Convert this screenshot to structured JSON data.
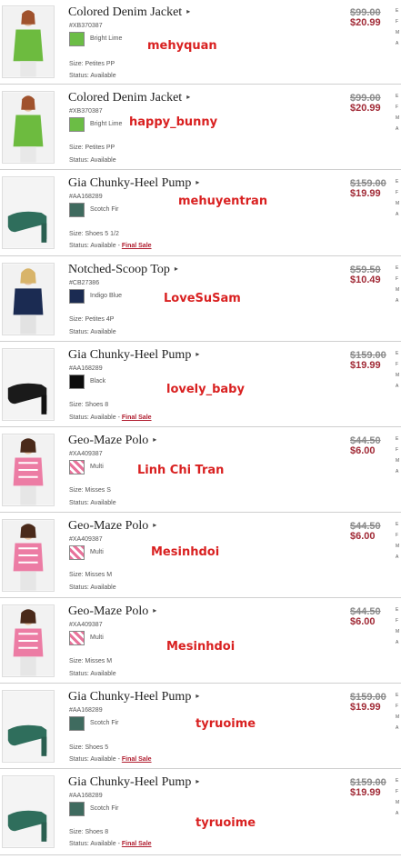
{
  "rows": [
    {
      "name": "Colored Denim Jacket",
      "sku": "#XB370387",
      "color_name": "Bright Lime",
      "swatch": "#6bbd45",
      "size": "Size: Petites  PP",
      "status": "Status: Available",
      "final_sale": "",
      "old_price": "$99.00",
      "new_price": "$20.99",
      "overlay": "mehyquan",
      "image": "green-jacket-model"
    },
    {
      "name": "Colored Denim Jacket",
      "sku": "#XB370387",
      "color_name": "Bright Lime",
      "swatch": "#6bbd45",
      "size": "Size: Petites  PP",
      "status": "Status: Available",
      "final_sale": "",
      "old_price": "$99.00",
      "new_price": "$20.99",
      "overlay": "happy_bunny",
      "image": "green-jacket-model"
    },
    {
      "name": "Gia Chunky-Heel Pump",
      "sku": "#AA168289",
      "color_name": "Scotch Fir",
      "swatch": "#3f6b5f",
      "size": "Size: Shoes  5 1/2",
      "status": "Status: Available - ",
      "final_sale": "Final Sale",
      "old_price": "$159.00",
      "new_price": "$19.99",
      "overlay": "mehuyentran",
      "image": "teal-pump-shoe"
    },
    {
      "name": "Notched-Scoop Top",
      "sku": "#CB27386",
      "color_name": "Indigo Blue",
      "swatch": "#1b2b52",
      "size": "Size: Petites  4P",
      "status": "Status: Available",
      "final_sale": "",
      "old_price": "$59.50",
      "new_price": "$10.49",
      "overlay": "LoveSuSam",
      "image": "navy-top-model"
    },
    {
      "name": "Gia Chunky-Heel Pump",
      "sku": "#AA168289",
      "color_name": "Black",
      "swatch": "#0d0d0d",
      "size": "Size: Shoes  8",
      "status": "Status: Available - ",
      "final_sale": "Final Sale",
      "old_price": "$159.00",
      "new_price": "$19.99",
      "overlay": "lovely_baby",
      "image": "black-pump-shoe"
    },
    {
      "name": "Geo-Maze Polo",
      "sku": "#XA409387",
      "color_name": "Multi",
      "swatch": "#e8729a",
      "size": "Size: Misses  S",
      "status": "Status: Available",
      "final_sale": "",
      "old_price": "$44.50",
      "new_price": "$6.00",
      "overlay": "Linh Chi Tran",
      "image": "pink-polo-model"
    },
    {
      "name": "Geo-Maze Polo",
      "sku": "#XA409387",
      "color_name": "Multi",
      "swatch": "#e8729a",
      "size": "Size: Misses  M",
      "status": "Status: Available",
      "final_sale": "",
      "old_price": "$44.50",
      "new_price": "$6.00",
      "overlay": "Mesinhdoi",
      "image": "pink-polo-model"
    },
    {
      "name": "Geo-Maze Polo",
      "sku": "#XA409387",
      "color_name": "Multi",
      "swatch": "#e8729a",
      "size": "Size: Misses  M",
      "status": "Status: Available",
      "final_sale": "",
      "old_price": "$44.50",
      "new_price": "$6.00",
      "overlay": "Mesinhdoi",
      "image": "pink-polo-model"
    },
    {
      "name": "Gia Chunky-Heel Pump",
      "sku": "#AA168289",
      "color_name": "Scotch Fir",
      "swatch": "#3f6b5f",
      "size": "Size: Shoes  5",
      "status": "Status: Available - ",
      "final_sale": "Final Sale",
      "old_price": "$159.00",
      "new_price": "$19.99",
      "overlay": "tyruoime",
      "image": "teal-pump-shoe"
    },
    {
      "name": "Gia Chunky-Heel Pump",
      "sku": "#AA168289",
      "color_name": "Scotch Fir",
      "swatch": "#3f6b5f",
      "size": "Size: Shoes  8",
      "status": "Status: Available - ",
      "final_sale": "Final Sale",
      "old_price": "$159.00",
      "new_price": "$19.99",
      "overlay": "tyruoime",
      "image": "teal-pump-shoe"
    }
  ],
  "colors": {
    "price_new": "#a12a36",
    "price_old": "#8a8a8a",
    "overlay_text": "#d92121",
    "final_sale": "#b01c2e"
  }
}
